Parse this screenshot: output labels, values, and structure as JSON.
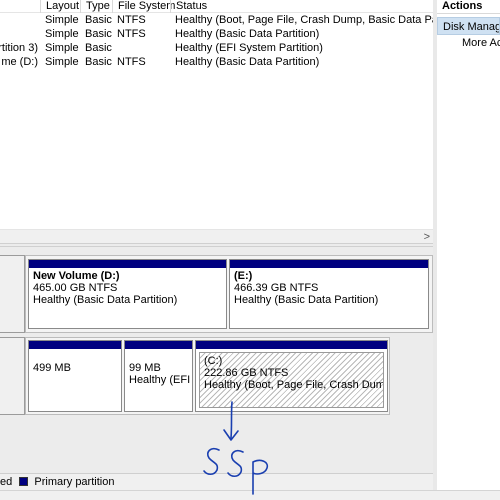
{
  "volume_list": {
    "columns": [
      "Layout",
      "Type",
      "File System",
      "Status"
    ],
    "rows": [
      {
        "volume": "",
        "layout": "Simple",
        "type": "Basic",
        "fs": "NTFS",
        "status": "Healthy (Boot, Page File, Crash Dump, Basic Data Partition)"
      },
      {
        "volume": "",
        "layout": "Simple",
        "type": "Basic",
        "fs": "NTFS",
        "status": "Healthy (Basic Data Partition)"
      },
      {
        "volume": "rtition 3)",
        "layout": "Simple",
        "type": "Basic",
        "fs": "",
        "status": "Healthy (EFI System Partition)"
      },
      {
        "volume": "me (D:)",
        "layout": "Simple",
        "type": "Basic",
        "fs": "NTFS",
        "status": "Healthy (Basic Data Partition)"
      }
    ]
  },
  "scrollbar": {
    "right_arrow": ">"
  },
  "disks": {
    "disk1": {
      "partitions": [
        {
          "name": "New Volume  (D:)",
          "size": "465.00 GB NTFS",
          "status": "Healthy (Basic Data Partition)"
        },
        {
          "name": "(E:)",
          "size": "466.39 GB NTFS",
          "status": "Healthy (Basic Data Partition)"
        }
      ]
    },
    "disk0": {
      "partitions": [
        {
          "name": "",
          "size": "499 MB",
          "status": ""
        },
        {
          "name": "",
          "size": "99 MB",
          "status": "Healthy (EFI S"
        },
        {
          "name": "(C:)",
          "size": "222.86 GB NTFS",
          "status": "Healthy (Boot, Page File, Crash Dump, Ba"
        }
      ]
    }
  },
  "legend": {
    "partial_label": "ed",
    "primary_label": "Primary partition",
    "primary_color": "#000080"
  },
  "actions": {
    "title": "Actions",
    "selected_item": "Disk Manage",
    "more_item": "More Ac"
  },
  "annotation": {
    "text": "SSD",
    "color": "#1a3fb0"
  }
}
